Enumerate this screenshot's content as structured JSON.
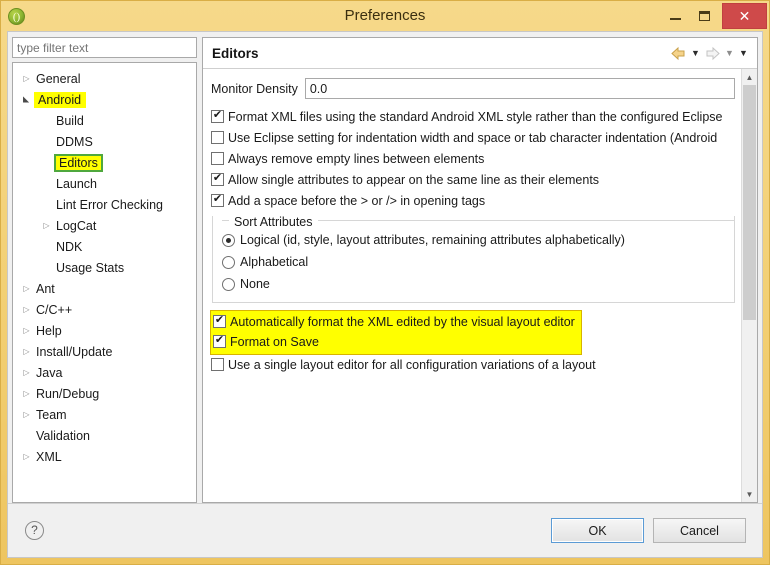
{
  "window": {
    "title": "Preferences",
    "app_icon": "eclipse-icon",
    "controls": {
      "minimize": "minimize-icon",
      "maximize": "maximize-icon",
      "close": "✕"
    }
  },
  "filter": {
    "placeholder": "type filter text",
    "value": ""
  },
  "tree": {
    "items": [
      {
        "label": "General",
        "indent": 0,
        "twisty": "collapsed",
        "highlight": "none"
      },
      {
        "label": "Android",
        "indent": 0,
        "twisty": "expanded",
        "highlight": "yellow"
      },
      {
        "label": "Build",
        "indent": 1,
        "twisty": "none",
        "highlight": "none"
      },
      {
        "label": "DDMS",
        "indent": 1,
        "twisty": "none",
        "highlight": "none"
      },
      {
        "label": "Editors",
        "indent": 1,
        "twisty": "none",
        "highlight": "green-outline"
      },
      {
        "label": "Launch",
        "indent": 1,
        "twisty": "none",
        "highlight": "none"
      },
      {
        "label": "Lint Error Checking",
        "indent": 1,
        "twisty": "none",
        "highlight": "none"
      },
      {
        "label": "LogCat",
        "indent": 1,
        "twisty": "collapsed",
        "highlight": "none"
      },
      {
        "label": "NDK",
        "indent": 1,
        "twisty": "none",
        "highlight": "none"
      },
      {
        "label": "Usage Stats",
        "indent": 1,
        "twisty": "none",
        "highlight": "none"
      },
      {
        "label": "Ant",
        "indent": 0,
        "twisty": "collapsed",
        "highlight": "none"
      },
      {
        "label": "C/C++",
        "indent": 0,
        "twisty": "collapsed",
        "highlight": "none"
      },
      {
        "label": "Help",
        "indent": 0,
        "twisty": "collapsed",
        "highlight": "none"
      },
      {
        "label": "Install/Update",
        "indent": 0,
        "twisty": "collapsed",
        "highlight": "none"
      },
      {
        "label": "Java",
        "indent": 0,
        "twisty": "collapsed",
        "highlight": "none"
      },
      {
        "label": "Run/Debug",
        "indent": 0,
        "twisty": "collapsed",
        "highlight": "none"
      },
      {
        "label": "Team",
        "indent": 0,
        "twisty": "collapsed",
        "highlight": "none"
      },
      {
        "label": "Validation",
        "indent": 0,
        "twisty": "none",
        "highlight": "none"
      },
      {
        "label": "XML",
        "indent": 0,
        "twisty": "collapsed",
        "highlight": "none"
      }
    ]
  },
  "page": {
    "title": "Editors",
    "nav": {
      "back": "back-arrow-icon",
      "back_menu": "▼",
      "forward": "forward-arrow-icon",
      "forward_menu": "▼",
      "view_menu": "▼"
    },
    "density": {
      "label": "Monitor Density",
      "value": "0.0"
    },
    "checkboxes_top": [
      {
        "label": "Format XML files using the standard Android XML style rather than the configured Eclipse",
        "checked": true
      },
      {
        "label": "Use Eclipse setting for indentation width and space or tab character indentation (Android",
        "checked": false
      },
      {
        "label": "Always remove empty lines between elements",
        "checked": false
      },
      {
        "label": "Allow single attributes to appear on the same line as their elements",
        "checked": true
      },
      {
        "label": "Add a space before the > or /> in opening tags",
        "checked": true
      }
    ],
    "sort_group": {
      "legend": "Sort Attributes",
      "options": [
        {
          "label": "Logical (id, style, layout attributes, remaining attributes alphabetically)",
          "selected": true
        },
        {
          "label": "Alphabetical",
          "selected": false
        },
        {
          "label": "None",
          "selected": false
        }
      ]
    },
    "highlighted_checkboxes": [
      {
        "label": "Automatically format the XML edited by the visual layout editor",
        "checked": true
      },
      {
        "label": "Format on Save",
        "checked": true
      }
    ],
    "checkboxes_bottom": [
      {
        "label": "Use a single layout editor for all configuration variations of a layout",
        "checked": false
      }
    ],
    "scrollbar": {
      "up": "▲",
      "down": "▼"
    }
  },
  "footer": {
    "help": "?",
    "ok_label": "OK",
    "cancel_label": "Cancel"
  },
  "colors": {
    "titlebar": "#f2cf73",
    "highlight_yellow": "#ffff00",
    "highlight_green_border": "#4fa83d",
    "close_red": "#cf4a4a",
    "default_button_border": "#5b9bd5"
  }
}
